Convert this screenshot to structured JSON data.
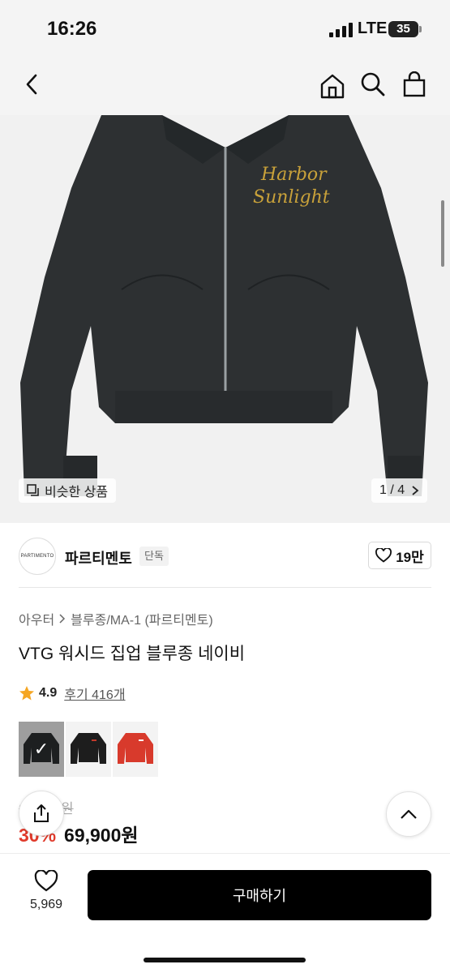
{
  "status_bar": {
    "time": "16:26",
    "network": "LTE",
    "battery": "35"
  },
  "nav": {
    "back_icon": "chevron-left-icon",
    "home_icon": "home-icon",
    "search_icon": "search-icon",
    "bag_icon": "shopping-bag-icon"
  },
  "hero": {
    "similar_label": "비슷한 상품",
    "pager": "1 / 4",
    "embroidery_line1": "Harbor",
    "embroidery_line2": "Sunlight",
    "jacket_color": "#2d3032"
  },
  "brand": {
    "logo_text": "PARTIMENTO",
    "name": "파르티멘토",
    "badge": "단독",
    "likes": "19만"
  },
  "product": {
    "breadcrumb": [
      "아우터",
      "블루종/MA-1 (파르티멘토)"
    ],
    "title": "VTG 워시드 집업 블루종 네이비",
    "rating": "4.9",
    "reviews": "후기 416개",
    "variants": [
      {
        "color": "#2d3032",
        "selected": true
      },
      {
        "color": "#1d1d1d",
        "selected": false
      },
      {
        "color": "#d83a2c",
        "selected": false
      }
    ],
    "original_price": "99,900원",
    "discount": "30%",
    "sale_price": "69,900원"
  },
  "bottom": {
    "wish_count": "5,969",
    "buy_label": "구매하기"
  },
  "colors": {
    "accent_discount": "#e03a2b",
    "star": "#f5a623",
    "buy_button": "#000000"
  }
}
